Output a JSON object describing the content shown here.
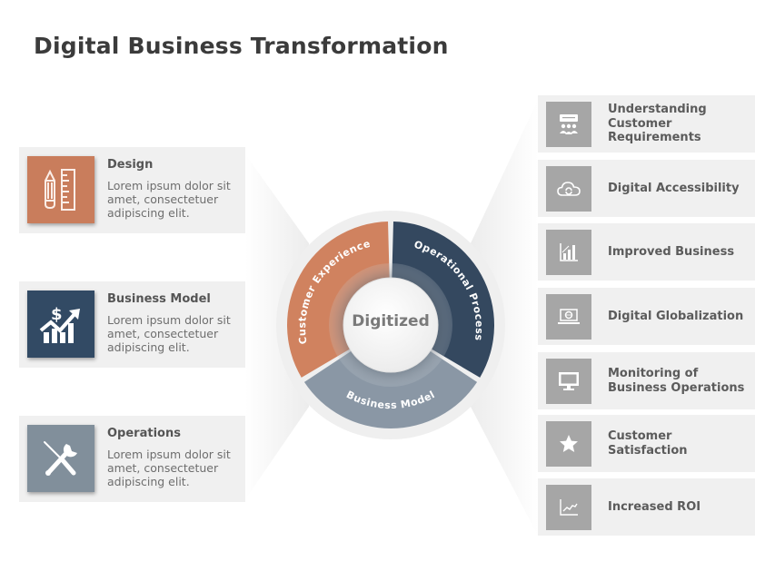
{
  "title": "Digital Business Transformation",
  "colors": {
    "design": "#c97d5c",
    "business_model": "#324a64",
    "operations": "#818f9b",
    "right_icon_bg": "#a6a6a6",
    "card_bg": "#f0f0f0",
    "segment_customer_experience": "#d0825f",
    "segment_operational_process": "#34485f",
    "segment_business_model": "#8a97a5"
  },
  "left_cards": [
    {
      "title": "Design",
      "description": "Lorem ipsum dolor sit amet, consectetuer adipiscing elit.",
      "icon": "pencil-ruler-icon"
    },
    {
      "title": "Business Model",
      "description": "Lorem ipsum dolor sit amet, consectetuer adipiscing elit.",
      "icon": "dollar-growth-chart-icon"
    },
    {
      "title": "Operations",
      "description": "Lorem ipsum dolor sit amet, consectetuer adipiscing elit.",
      "icon": "wrench-screwdriver-icon"
    }
  ],
  "wheel": {
    "center": "Digitized",
    "segments": [
      {
        "label": "Customer Experience"
      },
      {
        "label": "Operational Process"
      },
      {
        "label": "Business Model"
      }
    ]
  },
  "right_cards": [
    {
      "title": "Understanding Customer Requirements",
      "icon": "presentation-audience-icon"
    },
    {
      "title": "Digital Accessibility",
      "icon": "cloud-sync-icon"
    },
    {
      "title": "Improved Business",
      "icon": "bar-chart-icon"
    },
    {
      "title": "Digital Globalization",
      "icon": "laptop-globe-icon"
    },
    {
      "title": "Monitoring of Business Operations",
      "icon": "monitor-icon"
    },
    {
      "title": "Customer Satisfaction",
      "icon": "star-icon"
    },
    {
      "title": "Increased ROI",
      "icon": "line-chart-icon"
    }
  ]
}
